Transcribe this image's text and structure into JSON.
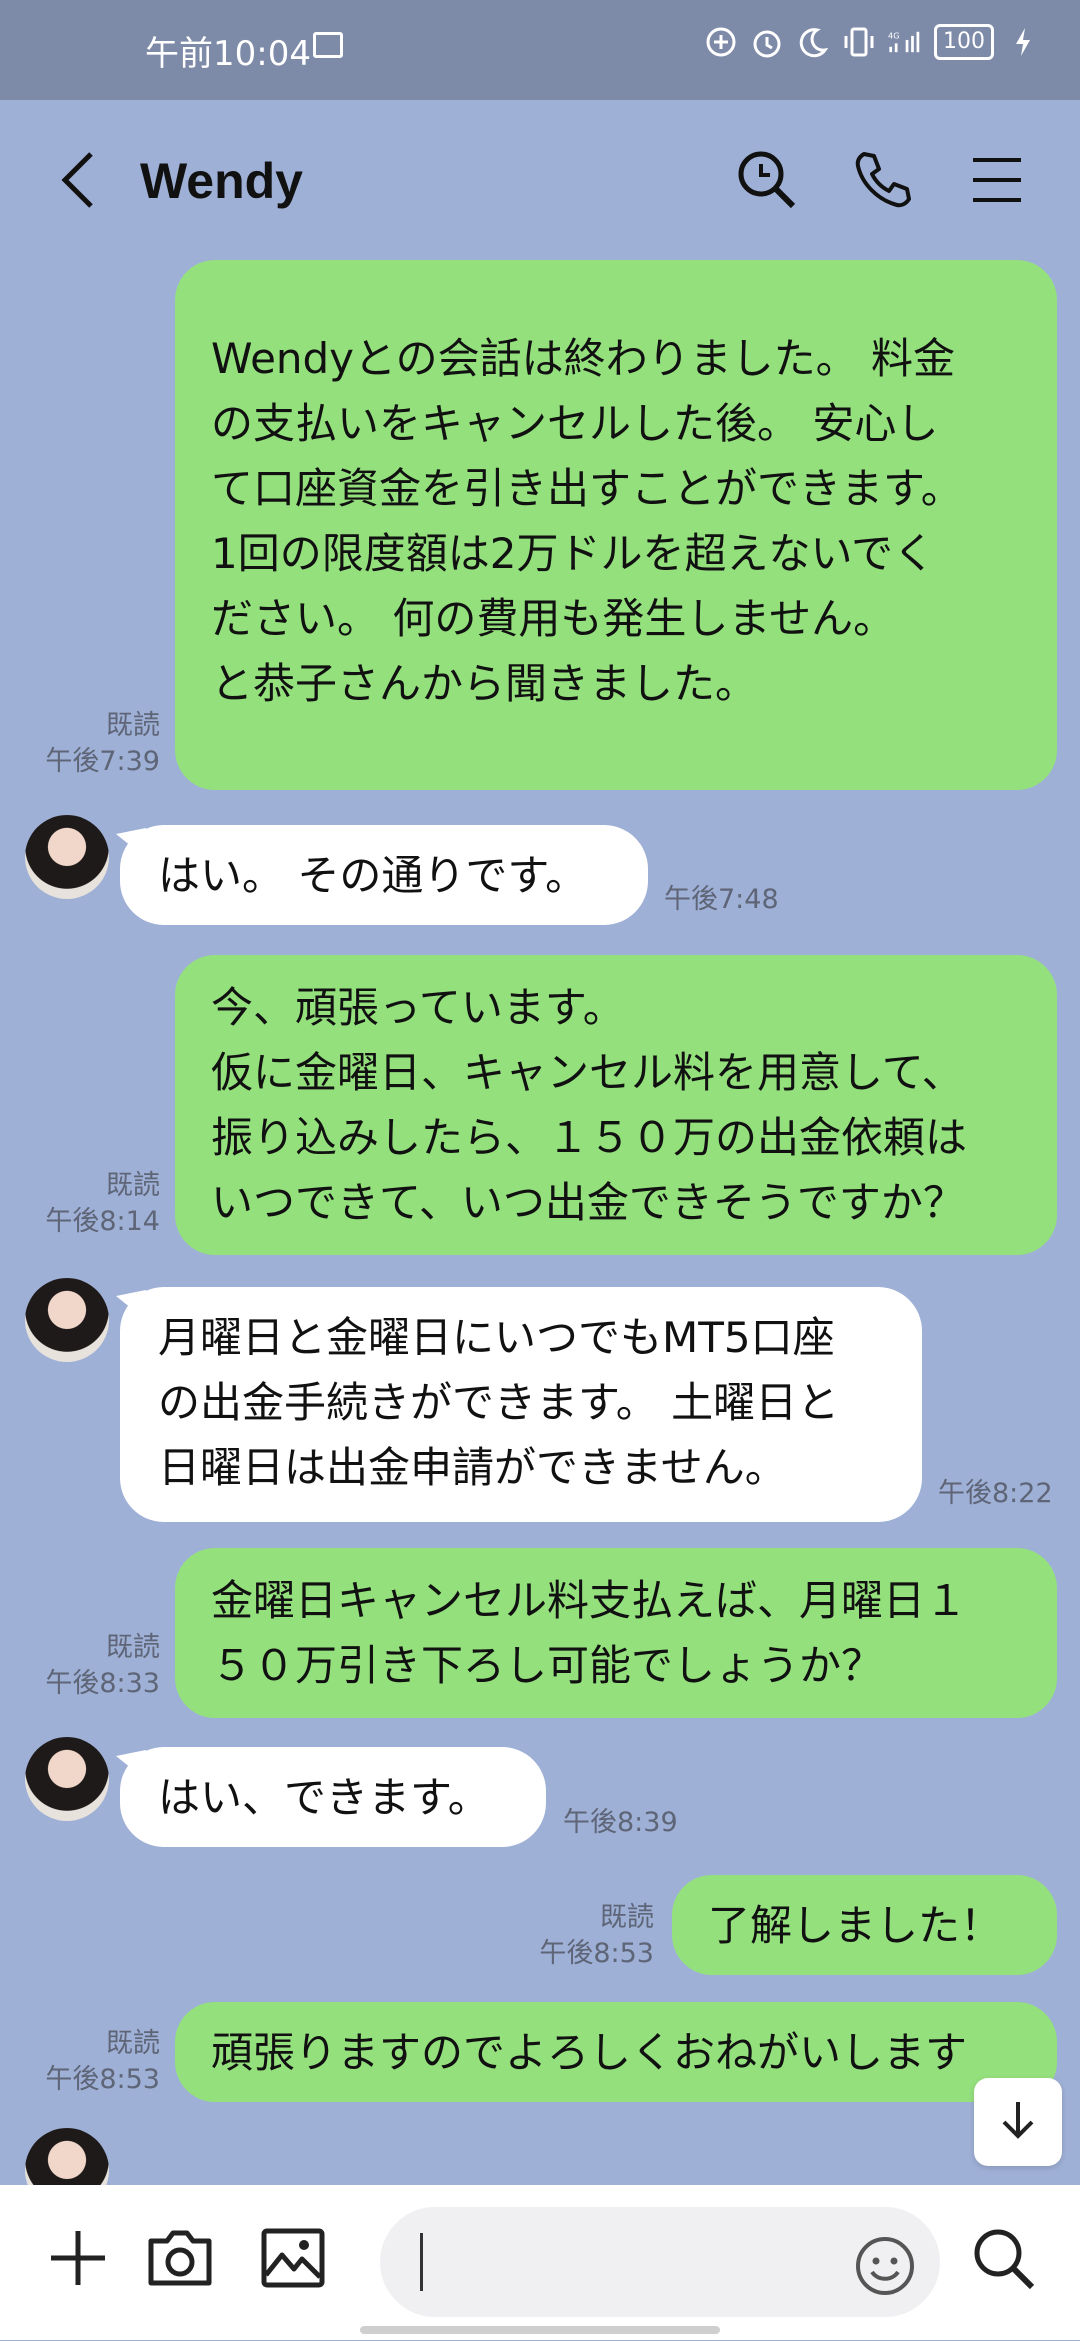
{
  "status_bar": {
    "time": "午前10:04",
    "battery": "100",
    "icons": [
      "image-icon",
      "plus-circle-icon",
      "alarm-icon",
      "moon-icon",
      "vibrate-icon",
      "4g-signal-icon",
      "battery-icon",
      "charging-icon"
    ]
  },
  "header": {
    "title": "Wendy",
    "icons": [
      "back-icon",
      "search-icon",
      "phone-icon",
      "menu-icon"
    ]
  },
  "messages": [
    {
      "from": "me",
      "text": "Wendyとの会話は終わりました。 料金\nの支払いをキャンセルした後。 安心し\nて口座資金を引き出すことができます。\n1回の限度額は2万ドルを超えないでく\nださい。 何の費用も発生しません。\nと恭子さんから聞きました。",
      "read": "既読",
      "time": "午後7:39"
    },
    {
      "from": "them",
      "text": "はい。 その通りです。",
      "time": "午後7:48"
    },
    {
      "from": "me",
      "text": "今、頑張っています。\n仮に金曜日、キャンセル料を用意して、\n振り込みしたら、１５０万の出金依頼は\nいつできて、いつ出金できそうですか？",
      "read": "既読",
      "time": "午後8:14"
    },
    {
      "from": "them",
      "text": "月曜日と金曜日にいつでもMT5口座\nの出金手続きができます。 土曜日と\n日曜日は出金申請ができません。",
      "time": "午後8:22"
    },
    {
      "from": "me",
      "text": "金曜日キャンセル料支払えば、月曜日１\n５０万引き下ろし可能でしょうか？",
      "read": "既読",
      "time": "午後8:33"
    },
    {
      "from": "them",
      "text": "はい、できます。",
      "time": "午後8:39"
    },
    {
      "from": "me",
      "text": "了解しました！",
      "read": "既読",
      "time": "午後8:53"
    },
    {
      "from": "me",
      "text": "頑張りますのでよろしくおねがいします",
      "read": "既読",
      "time": "午後8:53"
    }
  ],
  "input": {
    "placeholder": ""
  },
  "colors": {
    "background": "#9fb0d6",
    "my_bubble": "#94e07d",
    "their_bubble": "#ffffff",
    "status_bar": "#7d8aa8"
  }
}
